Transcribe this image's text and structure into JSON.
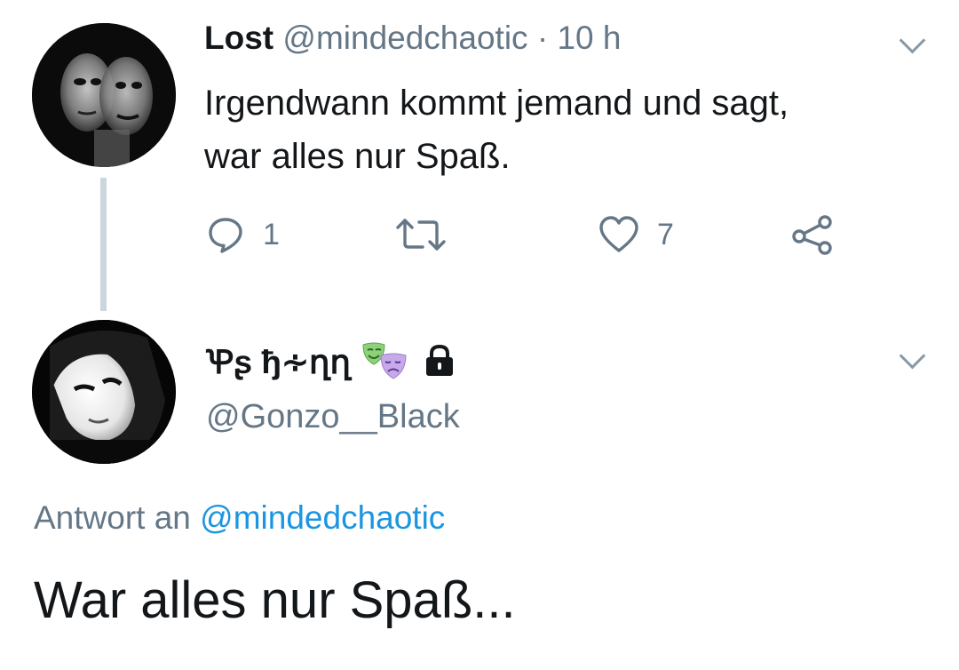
{
  "tweet1": {
    "author_name": "Lost",
    "handle": "@mindedchaotic",
    "separator": "·",
    "time": "10 h",
    "text_line1": "Irgendwann kommt jemand und sagt,",
    "text_line2": "war alles nur Spaß.",
    "reply_count": "1",
    "like_count": "7",
    "icons": [
      "reply-icon",
      "retweet-icon",
      "heart-icon",
      "share-icon",
      "chevron-down-icon"
    ]
  },
  "tweet2": {
    "author_name": "Ꝕʂ ђ∻ղղ",
    "name_emoji": "🎭",
    "handle": "@Gonzo__Black",
    "reply_prefix": "Antwort an",
    "reply_handle": "@mindedchaotic",
    "text": "War alles nur Spaß...",
    "icons": [
      "performing-arts-emoji-icon",
      "lock-icon",
      "chevron-down-icon"
    ]
  },
  "colors": {
    "text": "#14171a",
    "muted": "#657786",
    "link": "#1b95e0",
    "thread_line": "#ccd6dd"
  }
}
